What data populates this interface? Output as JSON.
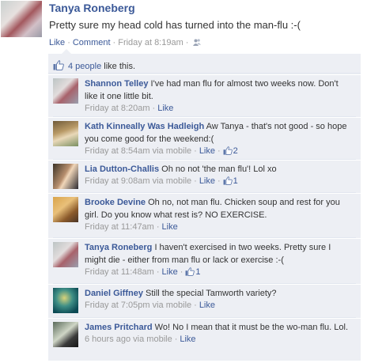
{
  "post": {
    "author": "Tanya Roneberg",
    "text": "Pretty sure my head cold has turned into the man-flu :-(",
    "actions": {
      "like": "Like",
      "comment": "Comment"
    },
    "timestamp": "Friday at 8:19am",
    "privacy_icon": "friends-icon"
  },
  "likes": {
    "icon": "thumbs-up-icon",
    "link": "4 people",
    "suffix": "like this."
  },
  "comments": [
    {
      "author": "Shannon Telley",
      "text": "I've had man flu for almost two weeks now. Don't like it one little bit.",
      "timestamp": "Friday at 8:20am",
      "via": "",
      "like": "Like",
      "like_count": ""
    },
    {
      "author": "Kath Kinneally Was Hadleigh",
      "text": "Aw Tanya - that's not good - so hope you come good for the weekend:(",
      "timestamp": "Friday at 8:54am",
      "via": "via mobile",
      "like": "Like",
      "like_count": "2"
    },
    {
      "author": "Lia Dutton-Challis",
      "text": "Oh no not 'the man flu'! Lol xo",
      "timestamp": "Friday at 9:08am",
      "via": "via mobile",
      "like": "Like",
      "like_count": "1"
    },
    {
      "author": "Brooke Devine",
      "text": "Oh no, not man flu. Chicken soup and rest for you girl. Do you know what rest is? NO EXERCISE.",
      "timestamp": "Friday at 11:47am",
      "via": "",
      "like": "Like",
      "like_count": ""
    },
    {
      "author": "Tanya Roneberg",
      "text": "I haven't exercised in two weeks. Pretty sure I might die - either from man flu or lack or exercise :-(",
      "timestamp": "Friday at 11:48am",
      "via": "",
      "like": "Like",
      "like_count": "1"
    },
    {
      "author": "Daniel Giffney",
      "text": "Still the special Tamworth variety?",
      "timestamp": "Friday at 7:05pm",
      "via": "via mobile",
      "like": "Like",
      "like_count": ""
    },
    {
      "author": "James Pritchard",
      "text": "Wo! No I mean that it must be the wo-man flu. Lol.",
      "timestamp": "6 hours ago",
      "via": "via mobile",
      "like": "Like",
      "like_count": ""
    }
  ],
  "colors": {
    "link": "#3b5998",
    "feedback_bg": "#edeff4",
    "meta": "#999999",
    "text": "#333333"
  }
}
